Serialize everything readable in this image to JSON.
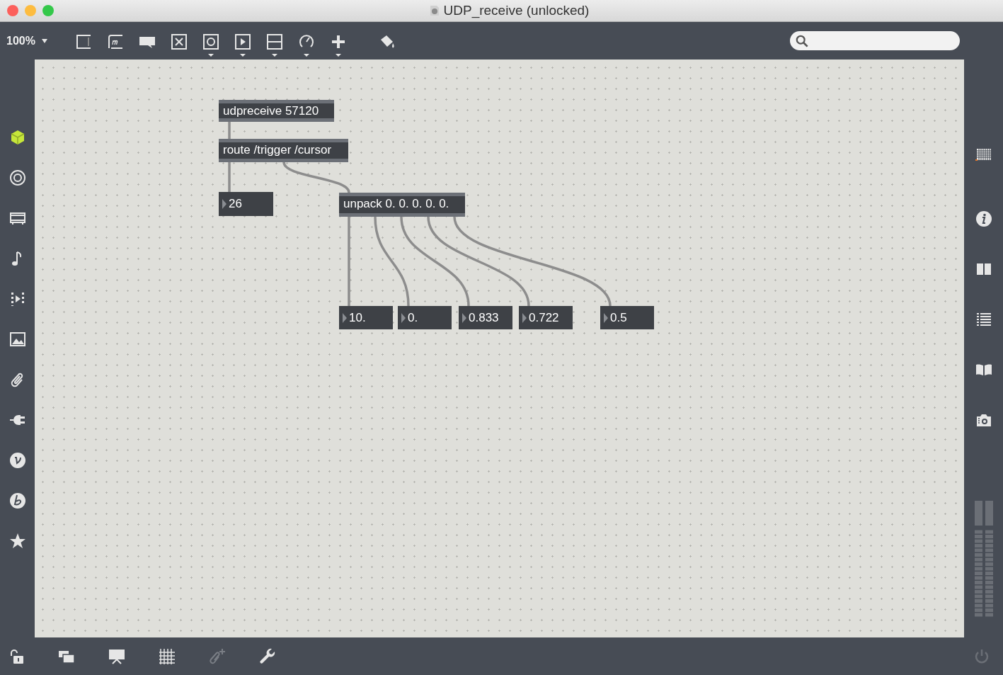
{
  "window": {
    "title": "UDP_receive (unlocked)"
  },
  "toolbar": {
    "zoom": "100%"
  },
  "patch": {
    "boxes": [
      {
        "kind": "object",
        "text": "udpreceive 57120"
      },
      {
        "kind": "object",
        "text": "route /trigger /cursor"
      },
      {
        "kind": "number",
        "text": "26"
      },
      {
        "kind": "object",
        "text": "unpack 0. 0. 0. 0. 0."
      },
      {
        "kind": "number",
        "text": "10."
      },
      {
        "kind": "number",
        "text": "0."
      },
      {
        "kind": "number",
        "text": "0.833"
      },
      {
        "kind": "number",
        "text": "0.722"
      },
      {
        "kind": "number",
        "text": "0.5"
      }
    ]
  }
}
